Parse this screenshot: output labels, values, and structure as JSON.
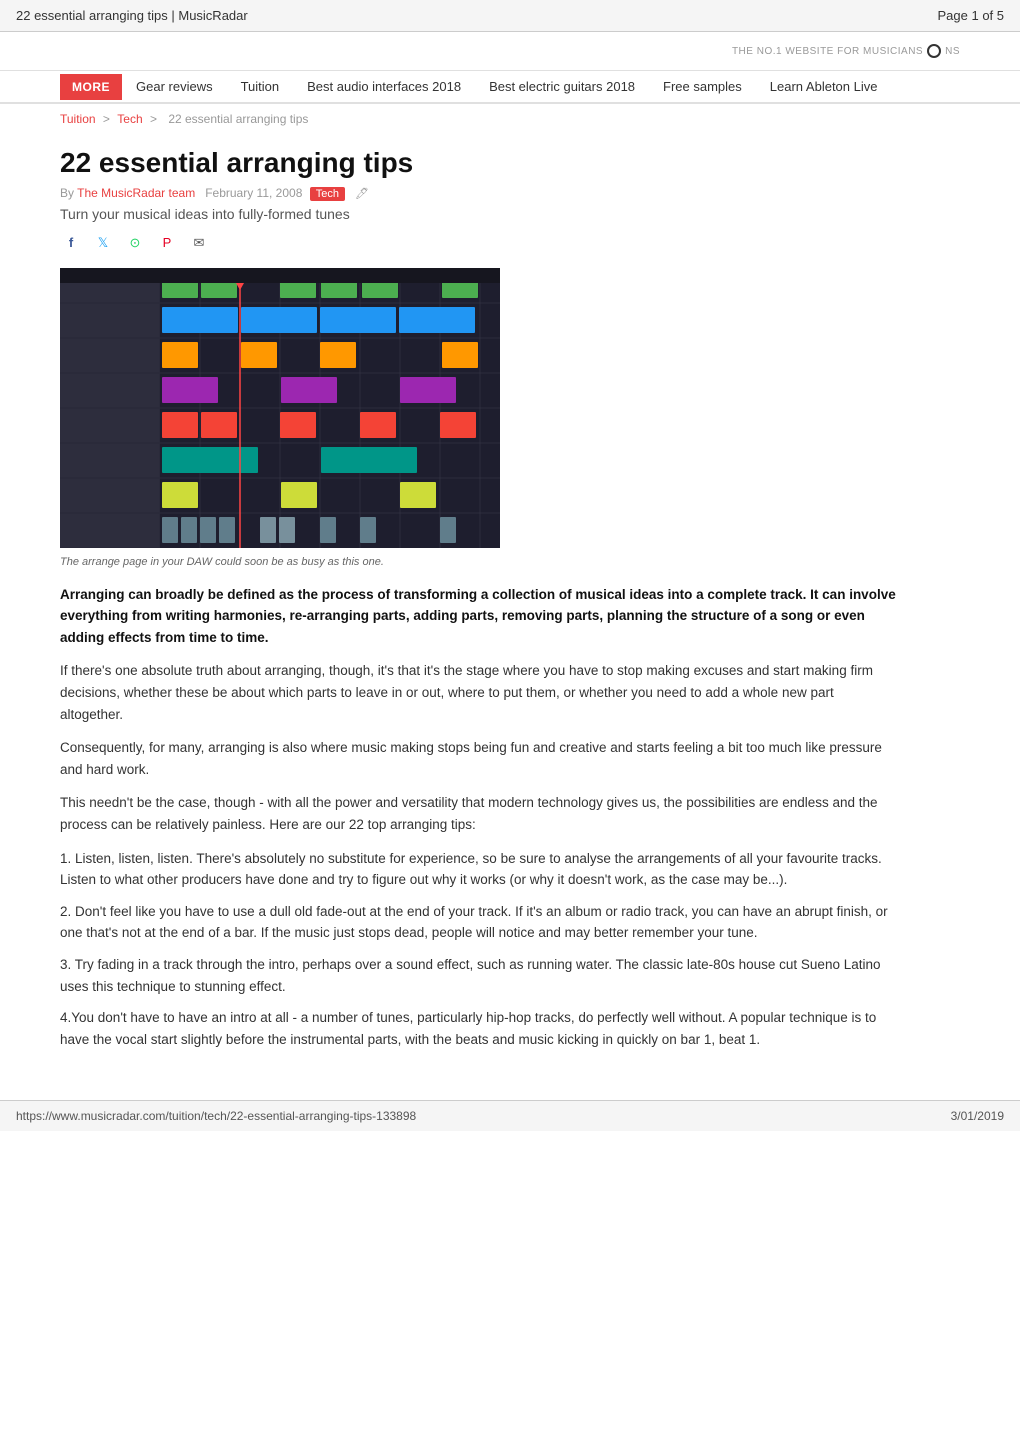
{
  "browser": {
    "title": "22 essential arranging tips | MusicRadar",
    "page_info": "Page 1 of 5",
    "url": "https://www.musicradar.com/tuition/tech/22-essential-arranging-tips-133898",
    "date": "3/01/2019"
  },
  "header": {
    "tagline": "THE NO.1 WEBSITE FOR MUSICIANS"
  },
  "nav": {
    "more_label": "MORE",
    "items": [
      "Gear reviews",
      "Tuition",
      "Best audio interfaces 2018",
      "Best electric guitars 2018",
      "Free samples",
      "Learn Ableton Live"
    ]
  },
  "breadcrumb": {
    "items": [
      "Tuition",
      "Tech"
    ],
    "current": "22 essential arranging tips"
  },
  "article": {
    "title": "22 essential arranging tips",
    "meta": {
      "by_label": "By",
      "author": "The MusicRadar team",
      "date": "February 11, 2008",
      "tag": "Tech"
    },
    "subtitle": "Turn your musical ideas into fully-formed tunes",
    "image_caption": "The arrange page in your DAW could soon be as busy as this one.",
    "social": {
      "facebook": "f",
      "twitter": "🐦",
      "whatsapp": "⊙",
      "pinterest": "P",
      "email": "✉"
    },
    "lead_paragraph": "Arranging can broadly be defined as the process of transforming a collection of musical ideas into a complete track. It can involve everything from writing harmonies, re-arranging parts, adding parts, removing parts, planning the structure of a song or even adding effects from time to time.",
    "paragraphs": [
      "If there's one absolute truth about arranging, though, it's that it's the stage where you have to stop making excuses and start making firm decisions, whether these be about which parts to leave in or out, where to put them, or whether you need to add a whole new part altogether.",
      "Consequently, for many, arranging is also where music making stops being fun and creative and starts feeling a bit too much like pressure and hard work.",
      "This needn't be the case, though - with all the power and versatility that modern technology gives us, the possibilities are endless and the process can be relatively painless. Here are our 22 top arranging tips:"
    ],
    "numbered_items": [
      "1. Listen, listen, listen. There's absolutely no substitute for experience, so be sure to analyse the arrangements of all your favourite tracks. Listen to what other producers have done and try to figure out why it works (or why it doesn't work, as the case may be...).",
      "2. Don't feel like you have to use a dull old fade-out at the end of your track. If it's an album or radio track, you can have an abrupt finish, or one that's not at the end of a bar. If the music just stops dead, people will notice and may better remember your tune.",
      "3. Try fading in a track through the intro, perhaps over a sound effect, such as running water. The classic late-80s house cut Sueno Latino uses this technique to stunning effect.",
      "4.You don't have to have an intro at all - a number of tunes, particularly hip-hop tracks, do perfectly well without. A popular technique is to have the vocal start slightly before the instrumental parts, with the beats and music kicking in quickly on bar 1, beat 1."
    ]
  }
}
